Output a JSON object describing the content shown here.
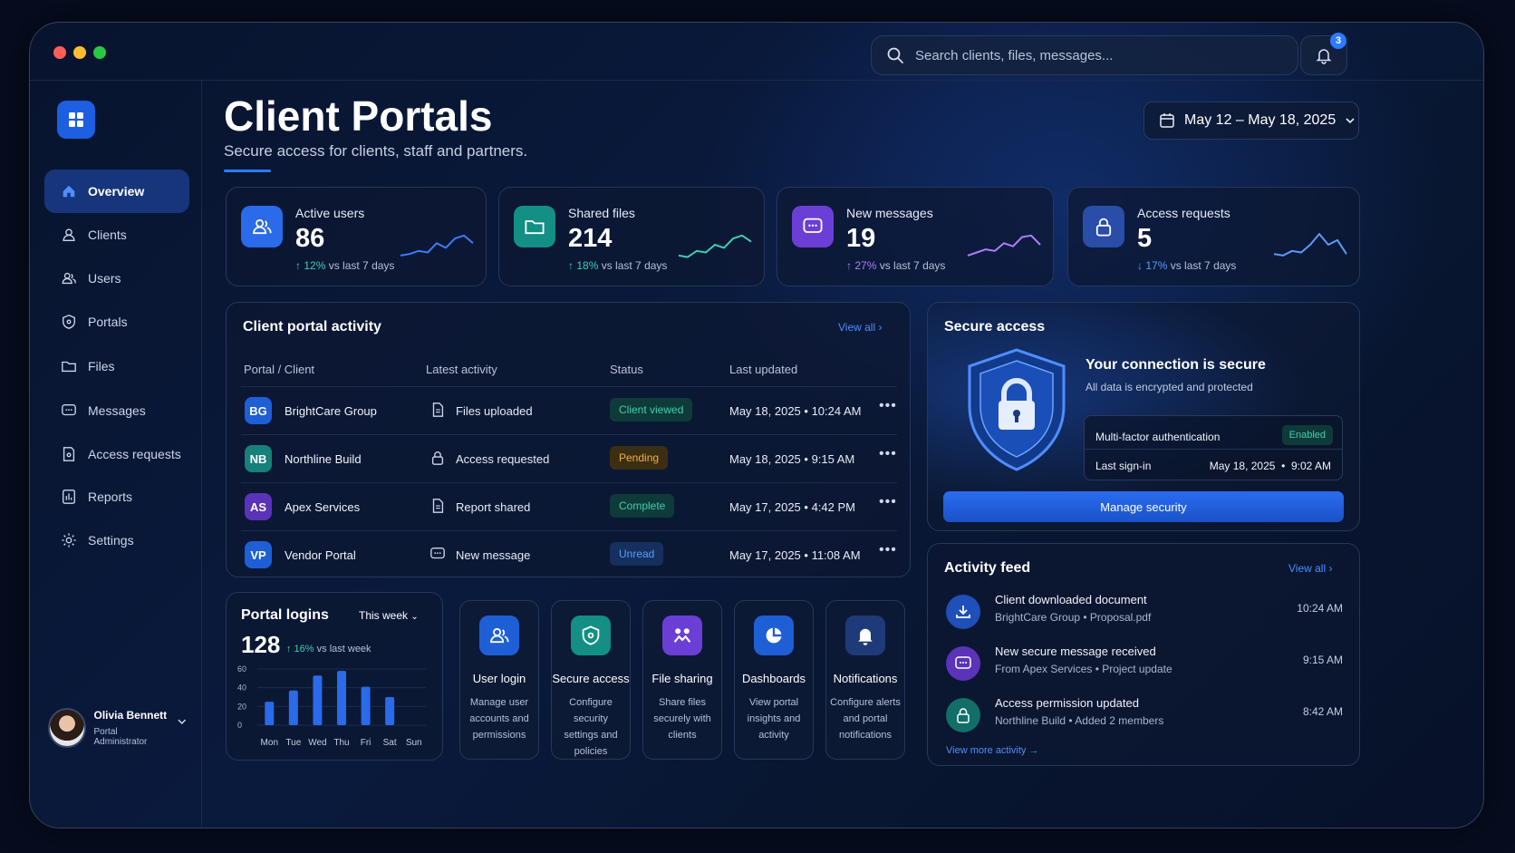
{
  "search": {
    "placeholder": "Search clients, files, messages..."
  },
  "notifications": {
    "count": "3"
  },
  "sidebar": {
    "items": [
      {
        "label": "Overview",
        "icon": "home-icon",
        "active": true
      },
      {
        "label": "Clients",
        "icon": "user-icon"
      },
      {
        "label": "Users",
        "icon": "users-icon"
      },
      {
        "label": "Portals",
        "icon": "shield-icon"
      },
      {
        "label": "Files",
        "icon": "folder-icon"
      },
      {
        "label": "Messages",
        "icon": "message-icon"
      },
      {
        "label": "Access requests",
        "icon": "key-icon"
      },
      {
        "label": "Reports",
        "icon": "report-icon"
      },
      {
        "label": "Settings",
        "icon": "gear-icon"
      }
    ],
    "user": {
      "name": "Olivia Bennett",
      "role": "Portal Administrator"
    }
  },
  "header": {
    "title": "Client Portals",
    "subtitle": "Secure access for clients, staff and partners.",
    "date_range": "May 12 – May 18, 2025"
  },
  "stats": [
    {
      "label": "Active users",
      "value": "86",
      "delta_arrow": "↑",
      "delta": "12%",
      "delta_suffix": "vs last 7 days",
      "color": "#2b6ae8",
      "delta_color": "#3ecfb0"
    },
    {
      "label": "Shared files",
      "value": "214",
      "delta_arrow": "↑",
      "delta": "18%",
      "delta_suffix": "vs last 7 days",
      "color": "#138f85",
      "delta_color": "#3ecfb0"
    },
    {
      "label": "New messages",
      "value": "19",
      "delta_arrow": "↑",
      "delta": "27%",
      "delta_suffix": "vs last 7 days",
      "color": "#6b3fd6",
      "delta_color": "#b07cff"
    },
    {
      "label": "Access requests",
      "value": "5",
      "delta_arrow": "↓",
      "delta": "17%",
      "delta_suffix": "vs last 7 days",
      "color": "#2a4da8",
      "delta_color": "#5b9bff"
    }
  ],
  "activity": {
    "title": "Client portal activity",
    "view_all": "View all",
    "columns": [
      "Portal / Client",
      "Latest activity",
      "Status",
      "Last updated"
    ],
    "rows": [
      {
        "initials": "BG",
        "name": "BrightCare Group",
        "activity": "Files uploaded",
        "status": "Client viewed",
        "date": "May 18, 2025",
        "time": "10:24 AM",
        "color": "#1f5fd6",
        "status_color": "#3ecfb0",
        "status_bg": "#0f3a3a"
      },
      {
        "initials": "NB",
        "name": "Northline Build",
        "activity": "Access requested",
        "status": "Pending",
        "date": "May 18, 2025",
        "time": "9:15 AM",
        "color": "#17807a",
        "status_color": "#f3b13c",
        "status_bg": "#3b2e12"
      },
      {
        "initials": "AS",
        "name": "Apex Services",
        "activity": "Report shared",
        "status": "Complete",
        "date": "May 17, 2025",
        "time": "4:42 PM",
        "color": "#5a33b8",
        "status_color": "#3ecfb0",
        "status_bg": "#0f3a3a"
      },
      {
        "initials": "VP",
        "name": "Vendor Portal",
        "activity": "New message",
        "status": "Unread",
        "date": "May 17, 2025",
        "time": "11:08 AM",
        "color": "#1f5fd6",
        "status_color": "#5b9bff",
        "status_bg": "#15305e"
      }
    ]
  },
  "secure": {
    "title": "Secure access",
    "headline": "Your connection is secure",
    "desc": "All data is encrypted and protected",
    "mfa_label": "Multi-factor authentication",
    "mfa_status": "Enabled",
    "signin_label": "Last sign-in",
    "signin_value": "May 18, 2025  •  9:02 AM",
    "button": "Manage security"
  },
  "logins": {
    "title": "Portal logins",
    "period": "This week",
    "total": "128",
    "delta": "↑ 16%",
    "delta_suffix": "vs last week"
  },
  "chart_data": {
    "type": "bar",
    "categories": [
      "Mon",
      "Tue",
      "Wed",
      "Thu",
      "Fri",
      "Sat",
      "Sun"
    ],
    "values": [
      25,
      37,
      53,
      58,
      41,
      30,
      0
    ],
    "ylim": [
      0,
      60
    ],
    "yticks": [
      "60",
      "40",
      "20",
      "0"
    ]
  },
  "features": [
    {
      "title": "User login",
      "desc": "Manage user accounts and permissions",
      "icon": "users-icon",
      "color": "#1f5fd6"
    },
    {
      "title": "Secure access",
      "desc": "Configure security settings and policies",
      "icon": "shield-icon",
      "color": "#138f85"
    },
    {
      "title": "File sharing",
      "desc": "Share files securely with clients",
      "icon": "share-icon",
      "color": "#6b3fd6"
    },
    {
      "title": "Dashboards",
      "desc": "View portal insights and activity",
      "icon": "pie-chart-icon",
      "color": "#1f5fd6"
    },
    {
      "title": "Notifications",
      "desc": "Configure alerts and portal notifications",
      "icon": "bell-icon",
      "color": "#1e3a78"
    }
  ],
  "feed": {
    "title": "Activity feed",
    "view_all": "View all",
    "more": "View more activity",
    "items": [
      {
        "title": "Client downloaded document",
        "sub1": "BrightCare Group",
        "sub2": "Proposal.pdf",
        "time": "10:24 AM",
        "icon": "download-icon",
        "color": "#1f4fb8"
      },
      {
        "title": "New secure message received",
        "sub1": "From Apex Services",
        "sub2": "Project update",
        "time": "9:15 AM",
        "icon": "message-icon",
        "color": "#5a33b8"
      },
      {
        "title": "Access permission updated",
        "sub1": "Northline Build",
        "sub2": "Added 2 members",
        "time": "8:42 AM",
        "icon": "lock-icon",
        "color": "#126e68"
      }
    ]
  }
}
